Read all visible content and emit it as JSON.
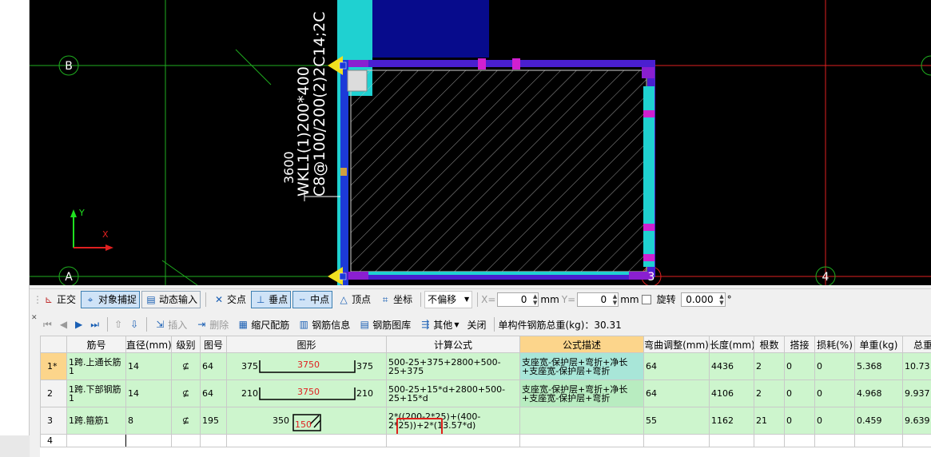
{
  "canvas": {
    "axis_labels": {
      "b": "B",
      "a": "A",
      "three": "3",
      "four": "4"
    },
    "beam_label": {
      "line1": "3600",
      "line2": "WKL1(1)200*400",
      "line3": "C8@100/200(2)2C14;2C"
    },
    "ucs": {
      "y": "Y",
      "x": "X"
    }
  },
  "toolbar1": {
    "ortho": "正交",
    "snap": "对象捕捉",
    "dynamic_input": "动态输入",
    "intersection": "交点",
    "perpendicular": "垂点",
    "midpoint": "中点",
    "vertex": "顶点",
    "coordinate": "坐标",
    "offset_mode": "不偏移",
    "x_label": "X=",
    "x_value": "0",
    "y_label": "Y=",
    "y_value": "0",
    "unit_mm": "mm",
    "rotate_label": "旋转",
    "rotate_value": "0.000",
    "degree": "°"
  },
  "toolbar2": {
    "insert": "插入",
    "delete": "删除",
    "scale_rebar": "缩尺配筋",
    "rebar_info": "钢筋信息",
    "rebar_library": "钢筋图库",
    "other": "其他",
    "close": "关闭",
    "total_weight_label": "单构件钢筋总重(kg)：30.31"
  },
  "table": {
    "headers": [
      "",
      "筋号",
      "直径(mm)",
      "级别",
      "图号",
      "图形",
      "计算公式",
      "公式描述",
      "弯曲调整(mm)",
      "长度(mm)",
      "根数",
      "搭接",
      "损耗(%)",
      "单重(kg)",
      "总重"
    ],
    "rows": [
      {
        "rn": "1*",
        "name": "1跨.上通长筋1",
        "dia": "14",
        "grade": "⊈",
        "fig": "64",
        "shape_left": "375",
        "shape_mid": "3750",
        "shape_right": "375",
        "formula": "500-25+375+2800+500-25+375",
        "desc": "支座宽-保护层+弯折+净长+支座宽-保护层+弯折",
        "bend": "64",
        "length": "4436",
        "count": "2",
        "lap": "0",
        "loss": "0",
        "unit_w": "5.368",
        "total_w": "10.73"
      },
      {
        "rn": "2",
        "name": "1跨.下部钢筋1",
        "dia": "14",
        "grade": "⊈",
        "fig": "64",
        "shape_left": "210",
        "shape_mid": "3750",
        "shape_right": "210",
        "formula": "500-25+15*d+2800+500-25+15*d",
        "desc": "支座宽-保护层+弯折+净长+支座宽-保护层+弯折",
        "bend": "64",
        "length": "4106",
        "count": "2",
        "lap": "0",
        "loss": "0",
        "unit_w": "4.968",
        "total_w": "9.937"
      },
      {
        "rn": "3",
        "name": "1跨.箍筋1",
        "dia": "8",
        "grade": "⊈",
        "fig": "195",
        "shape_left": "350",
        "shape_mid": "150",
        "shape_right": "",
        "formula": "2*((200-2*25)+(400-2*25))+2*(13.57*d)",
        "desc": "",
        "bend": "55",
        "length": "1162",
        "count": "21",
        "lap": "0",
        "loss": "0",
        "unit_w": "0.459",
        "total_w": "9.639"
      },
      {
        "rn": "4"
      }
    ]
  }
}
